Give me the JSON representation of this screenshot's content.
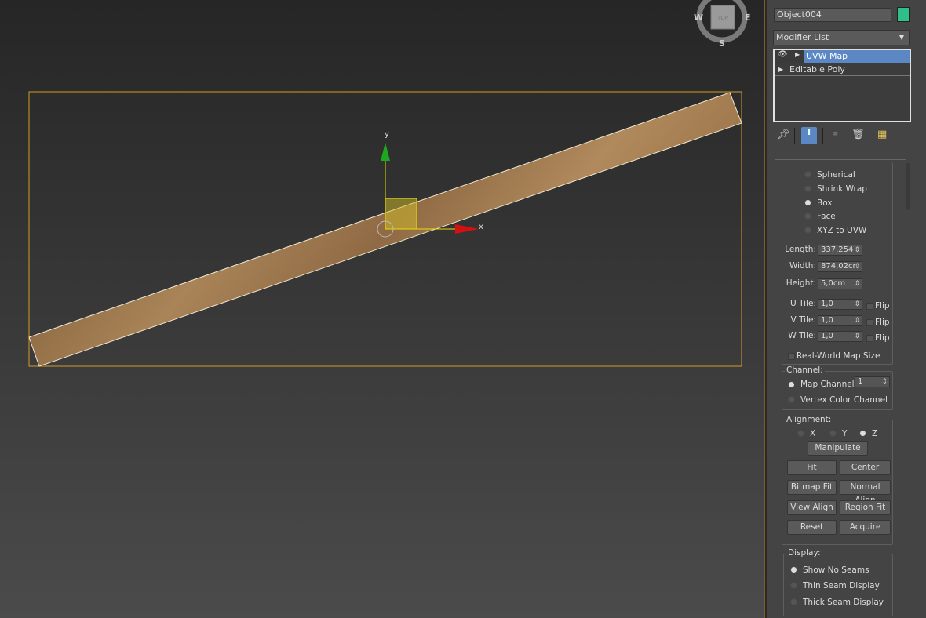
{
  "viewcube": {
    "face": "TOP",
    "west": "W",
    "east": "E",
    "south": "S"
  },
  "gizmo": {
    "x_label": "x",
    "y_label": "y"
  },
  "object_name": "Object004",
  "object_color": "#2fc08a",
  "modifier_list": "Modifier List",
  "stack": [
    {
      "label": "UVW Map",
      "selected": true
    },
    {
      "label": "Editable Poly",
      "selected": false
    }
  ],
  "mapping": {
    "options": [
      "Spherical",
      "Shrink Wrap",
      "Box",
      "Face",
      "XYZ to UVW"
    ],
    "selected": "Box"
  },
  "params": {
    "length_label": "Length:",
    "length": "337,254",
    "width_label": "Width:",
    "width": "874,02cr",
    "height_label": "Height:",
    "height": "5,0cm",
    "u_tile_label": "U Tile:",
    "u_tile": "1,0",
    "v_tile_label": "V Tile:",
    "v_tile": "1,0",
    "w_tile_label": "W Tile:",
    "w_tile": "1,0",
    "flip": "Flip",
    "real_world": "Real-World Map Size"
  },
  "channel": {
    "title": "Channel:",
    "map_channel": "Map Channel:",
    "map_channel_value": "1",
    "vertex_color": "Vertex Color Channel"
  },
  "alignment": {
    "title": "Alignment:",
    "x": "X",
    "y": "Y",
    "z": "Z",
    "manipulate": "Manipulate",
    "fit": "Fit",
    "center": "Center",
    "bitmap_fit": "Bitmap Fit",
    "normal_align": "Normal Align",
    "view_align": "View Align",
    "region_fit": "Region Fit",
    "reset": "Reset",
    "acquire": "Acquire"
  },
  "display": {
    "title": "Display:",
    "options": [
      "Show No Seams",
      "Thin Seam Display",
      "Thick Seam Display"
    ]
  }
}
